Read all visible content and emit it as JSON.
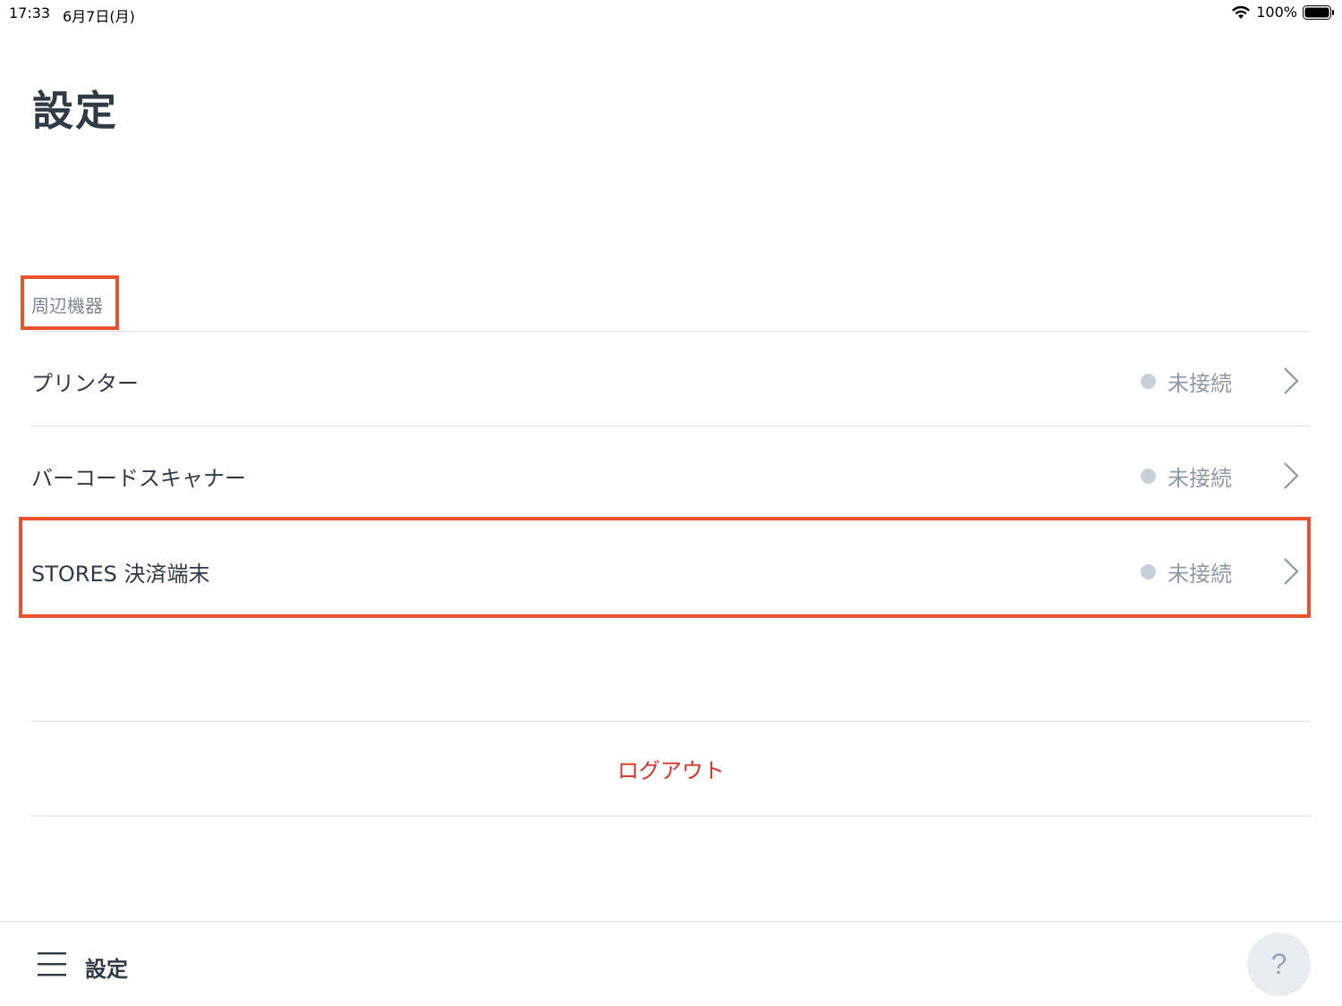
{
  "status_bar": {
    "time": "17:33",
    "date": "6月7日(月)",
    "battery": "100%",
    "icons": [
      "wifi-icon",
      "battery-icon"
    ]
  },
  "page": {
    "title": "設定"
  },
  "section": {
    "title": "周辺機器",
    "items": [
      {
        "label": "プリンター",
        "status": "未接続"
      },
      {
        "label": "バーコードスキャナー",
        "status": "未接続"
      },
      {
        "label": "STORES 決済端末",
        "status": "未接続"
      }
    ]
  },
  "logout": {
    "label": "ログアウト"
  },
  "bottom_bar": {
    "title": "設定",
    "help_label": "?",
    "icons": [
      "menu-icon"
    ]
  },
  "colors": {
    "highlight": "#e9522c",
    "logout": "#d8322a",
    "status_dot": "#c7cfd9"
  }
}
